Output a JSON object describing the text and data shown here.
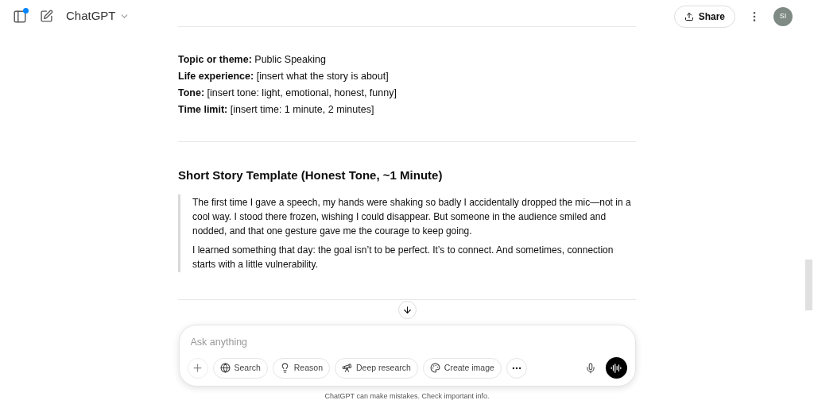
{
  "header": {
    "title": "ChatGPT",
    "share_label": "Share",
    "avatar_initials": "SI",
    "notification_dot": true
  },
  "fields": [
    "**Topic or theme:** Public Speaking",
    "**Life experience:** [insert what the story is about]",
    "**Tone:** [insert tone: light, emotional, honest, funny]",
    "**Time limit:** [insert time: 1 minute, 2 minutes]"
  ],
  "section_heading": "Short Story Template (Honest Tone, ~1 Minute)",
  "quote_paragraphs": [
    "The first time I gave a speech, my hands were shaking so badly I accidentally dropped the mic—not in a cool way. I stood there frozen, wishing I could disappear. But someone in the audience smiled and nodded, and that one gesture gave me the courage to keep going.",
    "I learned something that day: the goal isn’t to be perfect. It’s to connect. And sometimes, connection starts with a little vulnerability."
  ],
  "composer": {
    "placeholder": "Ask anything",
    "tools": [
      {
        "kind": "search",
        "label": "Search"
      },
      {
        "kind": "reason",
        "label": "Reason"
      },
      {
        "kind": "research",
        "label": "Deep research"
      },
      {
        "kind": "image",
        "label": "Create image"
      }
    ]
  },
  "disclaimer": "ChatGPT can make mistakes. Check important info."
}
